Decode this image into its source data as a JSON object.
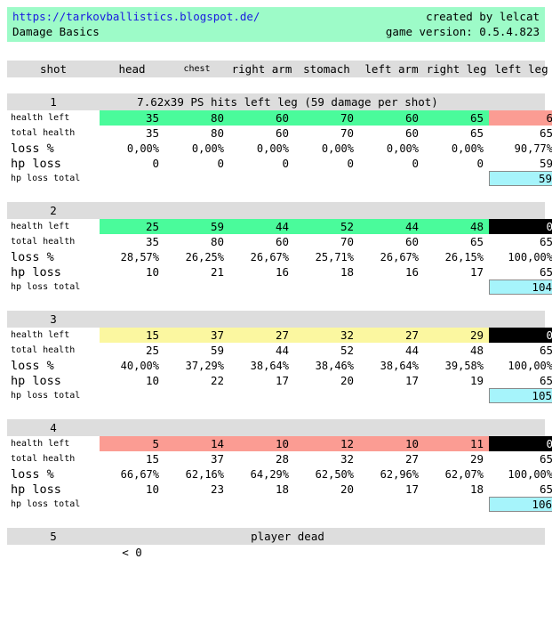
{
  "header": {
    "url": "https://tarkovballistics.blogspot.de/",
    "subtitle": "Damage Basics",
    "credit": "created by lelcat",
    "version": "game version: 0.5.4.823"
  },
  "columns": {
    "row_label": "shot",
    "parts": [
      "head",
      "chest",
      "right arm",
      "stomach",
      "left arm",
      "right leg",
      "left leg"
    ]
  },
  "row_labels": {
    "health_left": "health left",
    "total_health": "total health",
    "loss_pct": "loss %",
    "hp_loss": "hp loss",
    "hp_loss_total": "hp loss total"
  },
  "colors": {
    "banner_bg": "#9dfbc8",
    "link": "#1a1ae0",
    "strip_bg": "#dddddd",
    "green": "#4afb9b",
    "yellow": "#fbf7a0",
    "red": "#fb9c93",
    "black": "#000000",
    "cyan": "#a6f4fb"
  },
  "blocks": [
    {
      "number": "1",
      "description": "7.62x39 PS hits left leg (59 damage per shot)",
      "health_left": [
        "35",
        "80",
        "60",
        "70",
        "60",
        "65",
        "6"
      ],
      "health_left_fill": [
        "green",
        "green",
        "green",
        "green",
        "green",
        "green",
        "red"
      ],
      "total_health": [
        "35",
        "80",
        "60",
        "70",
        "60",
        "65",
        "65"
      ],
      "loss_pct": [
        "0,00%",
        "0,00%",
        "0,00%",
        "0,00%",
        "0,00%",
        "0,00%",
        "90,77%"
      ],
      "hp_loss": [
        "0",
        "0",
        "0",
        "0",
        "0",
        "0",
        "59"
      ],
      "hp_loss_total": "59"
    },
    {
      "number": "2",
      "description": "",
      "health_left": [
        "25",
        "59",
        "44",
        "52",
        "44",
        "48",
        "0"
      ],
      "health_left_fill": [
        "green",
        "green",
        "green",
        "green",
        "green",
        "green",
        "black"
      ],
      "total_health": [
        "35",
        "80",
        "60",
        "70",
        "60",
        "65",
        "65"
      ],
      "loss_pct": [
        "28,57%",
        "26,25%",
        "26,67%",
        "25,71%",
        "26,67%",
        "26,15%",
        "100,00%"
      ],
      "hp_loss": [
        "10",
        "21",
        "16",
        "18",
        "16",
        "17",
        "65"
      ],
      "hp_loss_total": "104"
    },
    {
      "number": "3",
      "description": "",
      "health_left": [
        "15",
        "37",
        "27",
        "32",
        "27",
        "29",
        "0"
      ],
      "health_left_fill": [
        "yellow",
        "yellow",
        "yellow",
        "yellow",
        "yellow",
        "yellow",
        "black"
      ],
      "total_health": [
        "25",
        "59",
        "44",
        "52",
        "44",
        "48",
        "65"
      ],
      "loss_pct": [
        "40,00%",
        "37,29%",
        "38,64%",
        "38,46%",
        "38,64%",
        "39,58%",
        "100,00%"
      ],
      "hp_loss": [
        "10",
        "22",
        "17",
        "20",
        "17",
        "19",
        "65"
      ],
      "hp_loss_total": "105"
    },
    {
      "number": "4",
      "description": "",
      "health_left": [
        "5",
        "14",
        "10",
        "12",
        "10",
        "11",
        "0"
      ],
      "health_left_fill": [
        "red",
        "red",
        "red",
        "red",
        "red",
        "red",
        "black"
      ],
      "total_health": [
        "15",
        "37",
        "28",
        "32",
        "27",
        "29",
        "65"
      ],
      "loss_pct": [
        "66,67%",
        "62,16%",
        "64,29%",
        "62,50%",
        "62,96%",
        "62,07%",
        "100,00%"
      ],
      "hp_loss": [
        "10",
        "23",
        "18",
        "20",
        "17",
        "18",
        "65"
      ],
      "hp_loss_total": "106"
    }
  ],
  "footer": {
    "number": "5",
    "status": "player dead",
    "sub_value": "< 0"
  }
}
